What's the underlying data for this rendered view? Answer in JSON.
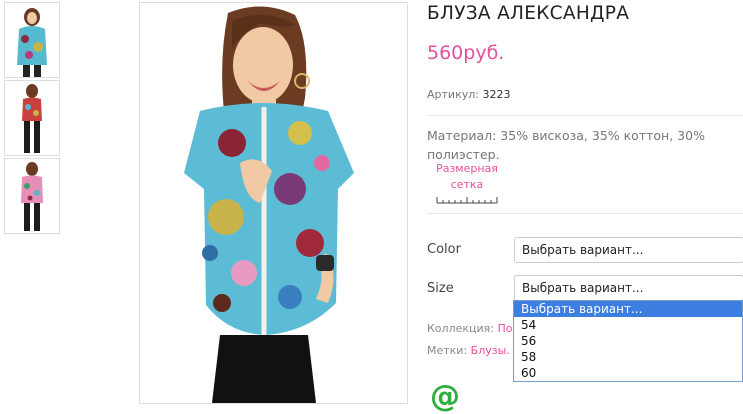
{
  "product": {
    "title": "БЛУЗА АЛЕКСАНДРА",
    "price": "560руб.",
    "sku_label": "Артикул:",
    "sku_value": "3223",
    "material": "Материал: 35% вискоза, 35% коттон, 30% полиэстер.",
    "size_chart_label": "Размерная сетка"
  },
  "options": {
    "color_label": "Color",
    "color_value": "Выбрать вариант...",
    "size_label": "Size",
    "size_value": "Выбрать вариант...",
    "size_dropdown": [
      "Выбрать вариант...",
      "54",
      "56",
      "58",
      "60"
    ]
  },
  "meta": {
    "collection_label": "Коллекция:",
    "collection_value": "По",
    "tags_label": "Метки:",
    "tags_value": "Блузы."
  },
  "gallery": {
    "thumbnails": [
      "thumbnail-1",
      "thumbnail-2",
      "thumbnail-3"
    ]
  },
  "icons": {
    "email": "email-at-icon"
  },
  "colors": {
    "accent": "#e5509b",
    "selection": "#3c7fe0",
    "email": "#2eae3c"
  }
}
